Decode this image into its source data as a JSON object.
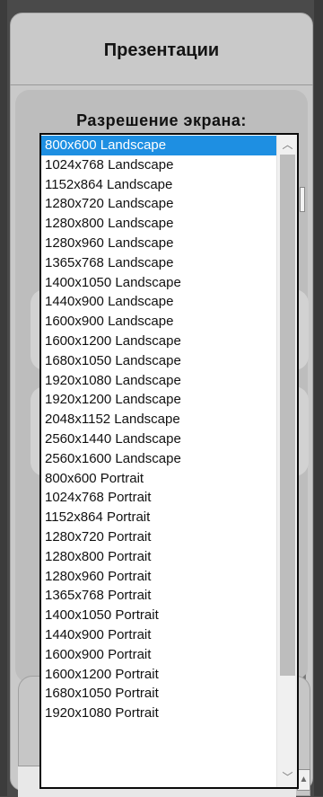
{
  "panel": {
    "title": "Презентации"
  },
  "resolution": {
    "label": "Разрешение экрана:",
    "selected_index": 0,
    "options": [
      "800x600 Landscape",
      "1024x768 Landscape",
      "1152x864 Landscape",
      "1280x720 Landscape",
      "1280x800 Landscape",
      "1280x960 Landscape",
      "1365x768 Landscape",
      "1400x1050 Landscape",
      "1440x900 Landscape",
      "1600x900 Landscape",
      "1600x1200 Landscape",
      "1680x1050 Landscape",
      "1920x1080 Landscape",
      "1920x1200 Landscape",
      "2048x1152 Landscape",
      "2560x1440 Landscape",
      "2560x1600 Landscape",
      "800x600 Portrait",
      "1024x768 Portrait",
      "1152x864 Portrait",
      "1280x720 Portrait",
      "1280x800 Portrait",
      "1280x960 Portrait",
      "1365x768 Portrait",
      "1400x1050 Portrait",
      "1440x900 Portrait",
      "1600x900 Portrait",
      "1600x1200 Portrait",
      "1680x1050 Portrait",
      "1920x1080 Portrait"
    ]
  },
  "icons": {
    "scroll_up": "chevron-up-icon",
    "scroll_down": "chevron-down-icon",
    "resize": "resize-grip-icon"
  },
  "colors": {
    "selected_bg": "#1e8fe2",
    "panel_bg": "#c9c9c9"
  }
}
